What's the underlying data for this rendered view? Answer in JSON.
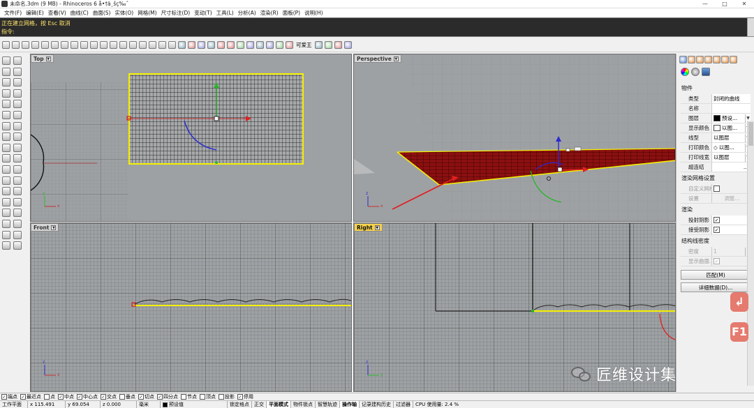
{
  "window": {
    "title": "未命名.3dm (9 MB) - Rhinoceros 6 å•†ä¸šç‰ˆ",
    "controls": [
      "—",
      "□",
      "✕"
    ]
  },
  "menu": [
    "文件(F)",
    "编辑(E)",
    "查看(V)",
    "曲线(C)",
    "曲面(S)",
    "实体(O)",
    "网格(M)",
    "尺寸标注(D)",
    "变动(T)",
    "工具(L)",
    "分析(A)",
    "渲染(R)",
    "面板(P)",
    "说明(H)"
  ],
  "command": {
    "history": "正在建立网格，按 Esc 取消",
    "prompt": "指令:"
  },
  "toolbar": {
    "user_label": "可爱王"
  },
  "viewports": {
    "top": "Top",
    "perspective": "Perspective",
    "front": "Front",
    "right": "Right"
  },
  "axes": {
    "x": "x",
    "y": "y",
    "z": "z"
  },
  "properties": {
    "object_header": "物件",
    "rows": [
      {
        "label": "类型",
        "value": "封闭的曲线"
      },
      {
        "label": "名称",
        "value": ""
      },
      {
        "label": "图层",
        "value": "预设..."
      },
      {
        "label": "显示颜色",
        "value": "以图..."
      },
      {
        "label": "线型",
        "value": "以图层"
      },
      {
        "label": "打印颜色",
        "value": "以图..."
      },
      {
        "label": "打印线宽",
        "value": "以图层"
      },
      {
        "label": "超连结",
        "value": "..."
      }
    ],
    "render_mesh_header": "渲染网格设置",
    "custom_mesh_label": "自定义网格",
    "settings_label": "设置",
    "adjust_label": "调整...",
    "render_header": "渲染",
    "cast_shadows_label": "投射阴影",
    "receive_shadows_label": "接受阴影",
    "isocurve_header": "结构线密度",
    "density_label": "密度",
    "density_value": "1",
    "show_surface_label": "显示曲面...",
    "match_button": "匹配(M)",
    "details_button": "详细数据(D)..."
  },
  "colors": {
    "layer_swatch": "#000000",
    "display_swatch": "#ffffff",
    "selection": "#ffff00",
    "viewport_bg": "#9ea1a4",
    "command_text": "#ffe36b",
    "accent_badge": "#e57a6e"
  },
  "float_buttons": [
    "↲",
    "F1"
  ],
  "osnaps": [
    {
      "label": "端点",
      "checked": true
    },
    {
      "label": "最近点",
      "checked": true
    },
    {
      "label": "点",
      "checked": false
    },
    {
      "label": "中点",
      "checked": true
    },
    {
      "label": "中心点",
      "checked": true
    },
    {
      "label": "交点",
      "checked": true
    },
    {
      "label": "垂点",
      "checked": false
    },
    {
      "label": "切点",
      "checked": true
    },
    {
      "label": "四分点",
      "checked": true
    },
    {
      "label": "节点",
      "checked": false
    },
    {
      "label": "顶点",
      "checked": false
    },
    {
      "label": "投影",
      "checked": false
    },
    {
      "label": "停用",
      "checked": true
    }
  ],
  "status": {
    "cplane": "工作平面",
    "x": "x 115.491",
    "y": "y 69.054",
    "z": "z 0.000",
    "units": "毫米",
    "layer": "预设值",
    "toggles": [
      {
        "label": "锁定格点",
        "on": false
      },
      {
        "label": "正交",
        "on": false
      },
      {
        "label": "平面模式",
        "on": true
      },
      {
        "label": "物件锁点",
        "on": false
      },
      {
        "label": "智慧轨迹",
        "on": false
      },
      {
        "label": "操作轴",
        "on": true
      },
      {
        "label": "记录建构历史",
        "on": false
      },
      {
        "label": "过滤器",
        "on": false
      }
    ],
    "cpu": "CPU 使用量: 2.4 %"
  },
  "watermark": "匠维设计集中营"
}
